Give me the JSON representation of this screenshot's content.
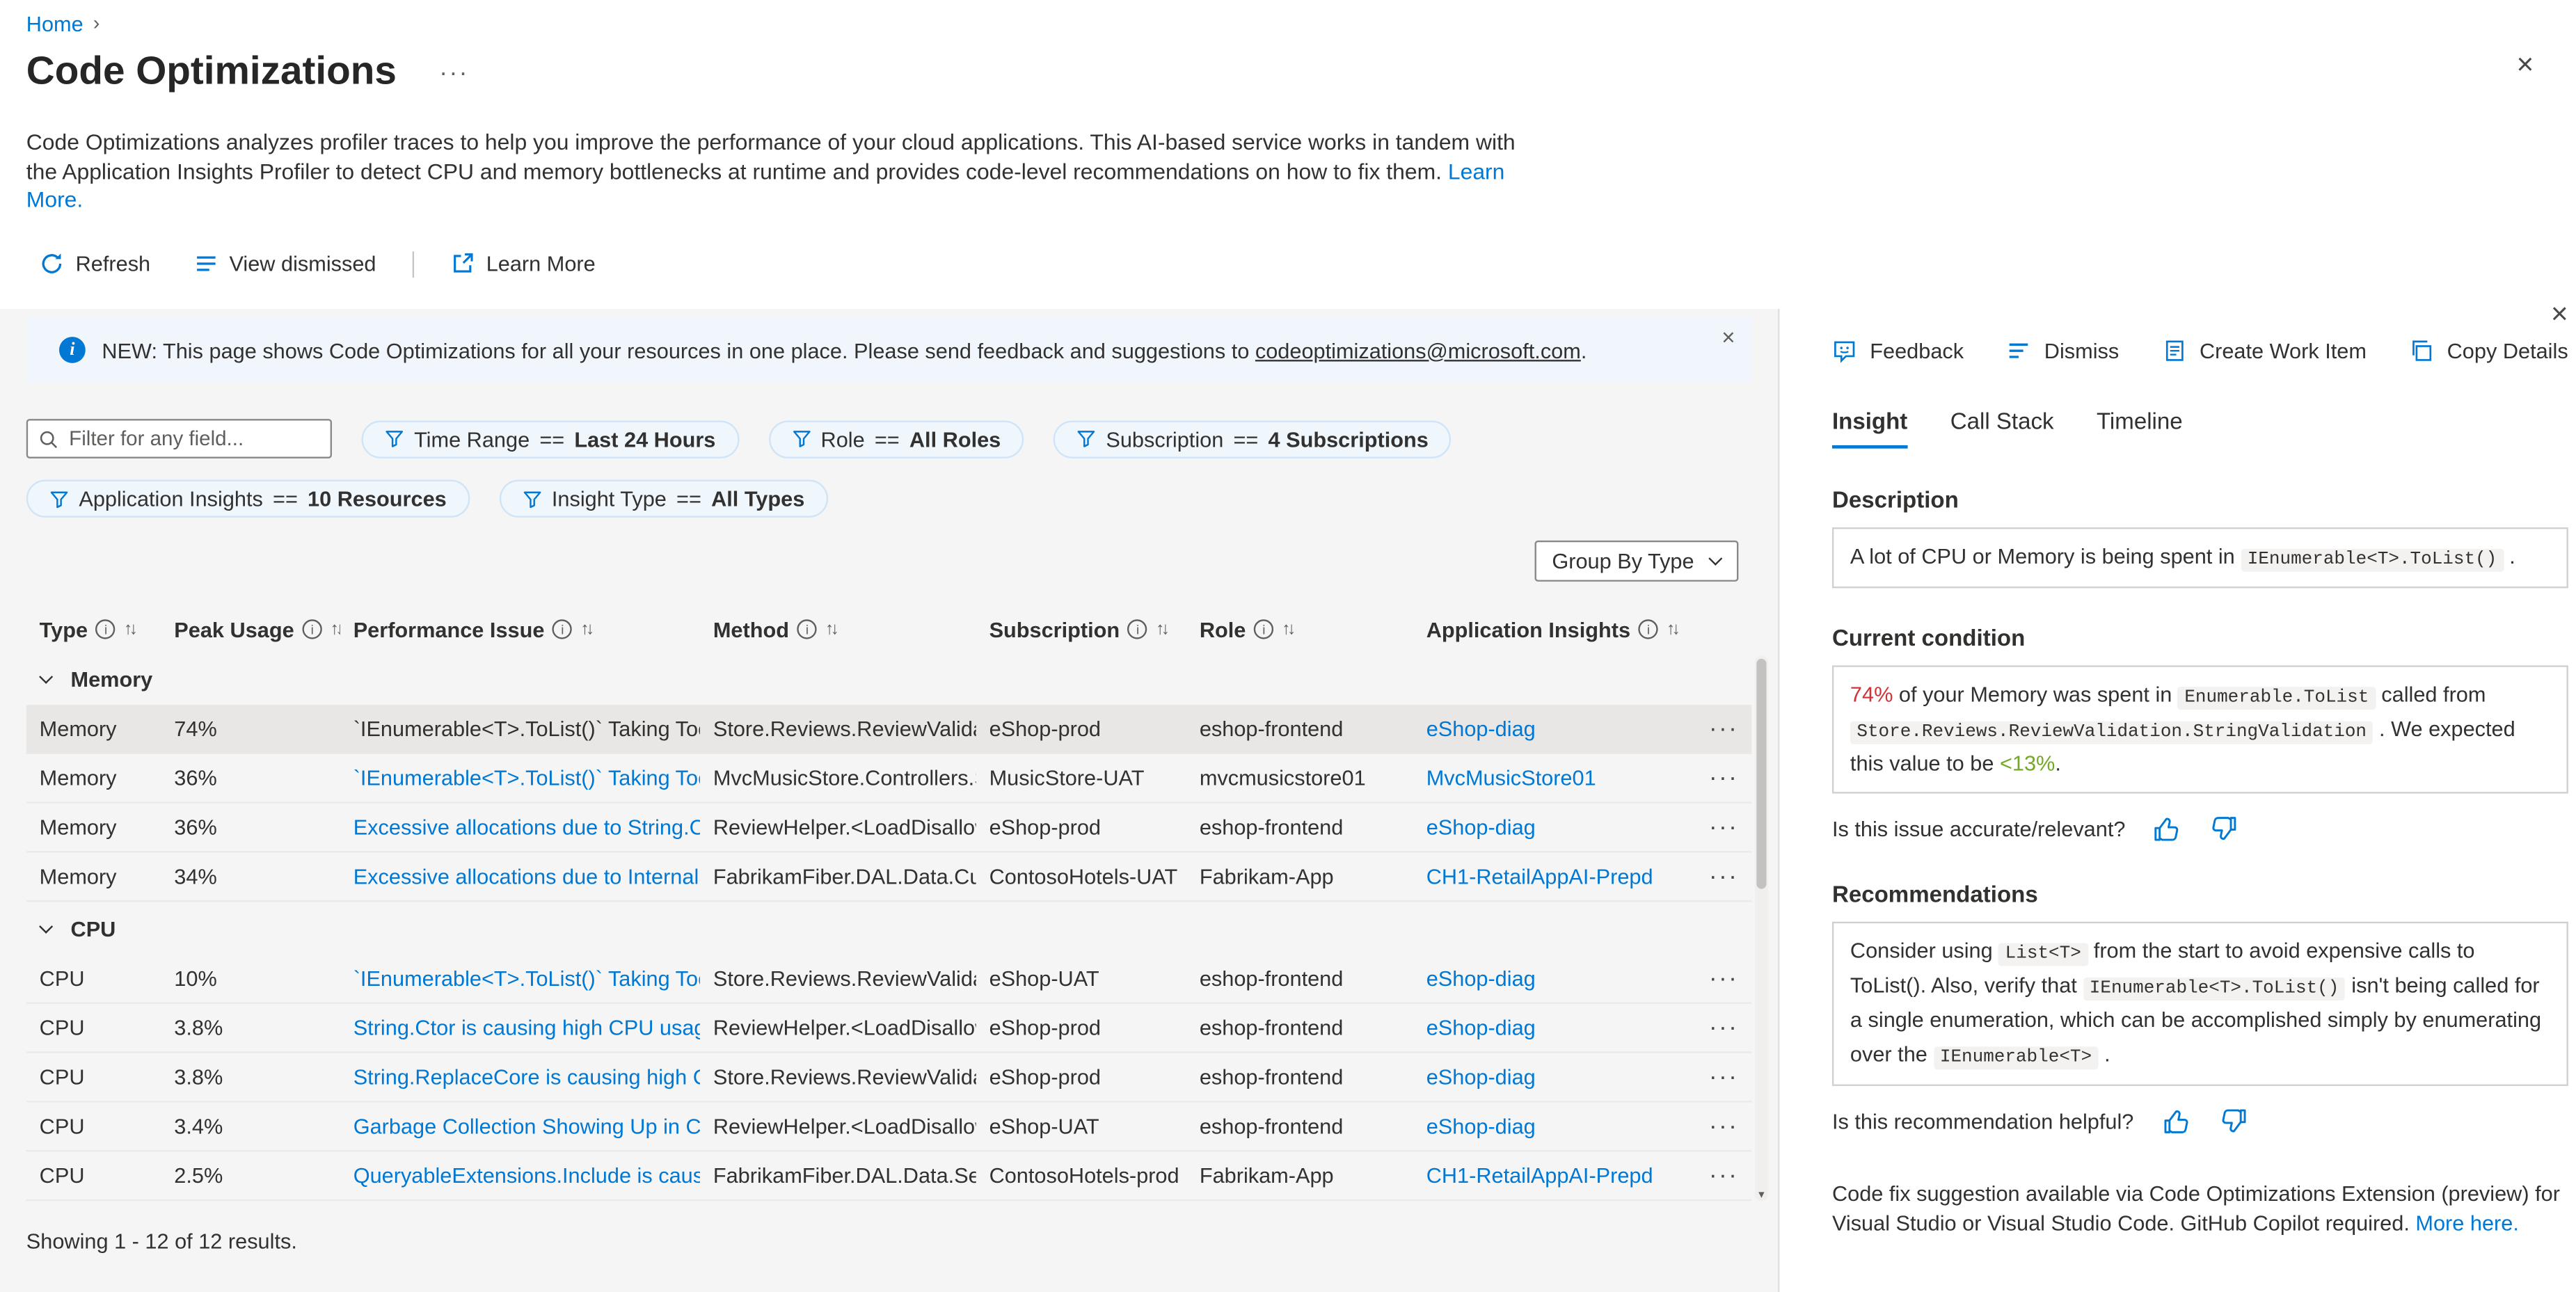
{
  "colors": {
    "accent": "#0078d4",
    "bad": "#d13438",
    "good": "#73aa24",
    "banner_bg": "#f0f6fc",
    "panel_bg": "#f5f5f5"
  },
  "breadcrumb": {
    "home": "Home"
  },
  "header": {
    "title": "Code Optimizations",
    "description": "Code Optimizations analyzes profiler traces to help you improve the performance of your cloud applications. This AI-based service works in tandem with the Application Insights Profiler to detect CPU and memory bottlenecks at runtime and provides code-level recommendations on how to fix them.",
    "learn_more_link": "Learn More."
  },
  "toolbar": {
    "refresh": "Refresh",
    "view_dismissed": "View dismissed",
    "learn_more": "Learn More"
  },
  "banner": {
    "text": "NEW: This page shows Code Optimizations for all your resources in one place. Please send feedback and suggestions to ",
    "link": "codeoptimizations@microsoft.com",
    "suffix": "."
  },
  "filters": {
    "search_placeholder": "Filter for any field...",
    "pills": [
      {
        "field": "Time Range",
        "op": "==",
        "value": "Last 24 Hours"
      },
      {
        "field": "Role",
        "op": "==",
        "value": "All Roles"
      },
      {
        "field": "Subscription",
        "op": "==",
        "value": "4 Subscriptions"
      },
      {
        "field": "Application Insights",
        "op": "==",
        "value": "10 Resources"
      },
      {
        "field": "Insight Type",
        "op": "==",
        "value": "All Types"
      }
    ]
  },
  "group_by": {
    "label": "Group By Type"
  },
  "table": {
    "columns": [
      "Type",
      "Peak Usage",
      "Performance Issue",
      "Method",
      "Subscription",
      "Role",
      "Application Insights"
    ],
    "groups": [
      {
        "name": "Memory",
        "rows": [
          {
            "type": "Memory",
            "peak": "74%",
            "issue": "`IEnumerable<T>.ToList()` Taking Too M",
            "method": "Store.Reviews.ReviewValidatio",
            "subscription": "eShop-prod",
            "role": "eshop-frontend",
            "app_insights": "eShop-diag",
            "selected": true
          },
          {
            "type": "Memory",
            "peak": "36%",
            "issue": "`IEnumerable<T>.ToList()` Taking Too M",
            "method": "MvcMusicStore.Controllers.Stc",
            "subscription": "MusicStore-UAT",
            "role": "mvcmusicstore01",
            "app_insights": "MvcMusicStore01"
          },
          {
            "type": "Memory",
            "peak": "36%",
            "issue": "Excessive allocations due to String.Ctor",
            "method": "ReviewHelper.<LoadDisallowe",
            "subscription": "eShop-prod",
            "role": "eshop-frontend",
            "app_insights": "eShop-diag"
          },
          {
            "type": "Memory",
            "peak": "34%",
            "issue": "Excessive allocations due to InternalSet",
            "method": "FabrikamFiber.DAL.Data.Custc",
            "subscription": "ContosoHotels-UAT",
            "role": "Fabrikam-App",
            "app_insights": "CH1-RetailAppAI-Prepd"
          }
        ]
      },
      {
        "name": "CPU",
        "rows": [
          {
            "type": "CPU",
            "peak": "10%",
            "issue": "`IEnumerable<T>.ToList()` Taking Too M",
            "method": "Store.Reviews.ReviewValidatio",
            "subscription": "eShop-UAT",
            "role": "eshop-frontend",
            "app_insights": "eShop-diag"
          },
          {
            "type": "CPU",
            "peak": "3.8%",
            "issue": "String.Ctor is causing high CPU usage",
            "method": "ReviewHelper.<LoadDisallowe",
            "subscription": "eShop-prod",
            "role": "eshop-frontend",
            "app_insights": "eShop-diag"
          },
          {
            "type": "CPU",
            "peak": "3.8%",
            "issue": "String.ReplaceCore is causing high CPU",
            "method": "Store.Reviews.ReviewValidatio",
            "subscription": "eShop-prod",
            "role": "eshop-frontend",
            "app_insights": "eShop-diag"
          },
          {
            "type": "CPU",
            "peak": "3.4%",
            "issue": "Garbage Collection Showing Up in CPU",
            "method": "ReviewHelper.<LoadDisallowe",
            "subscription": "eShop-UAT",
            "role": "eshop-frontend",
            "app_insights": "eShop-diag"
          },
          {
            "type": "CPU",
            "peak": "2.5%",
            "issue": "QueryableExtensions.Include is causing",
            "method": "FabrikamFiber.DAL.Data.Servic",
            "subscription": "ContosoHotels-prod",
            "role": "Fabrikam-App",
            "app_insights": "CH1-RetailAppAI-Prepd"
          }
        ]
      }
    ]
  },
  "results_summary": "Showing 1 - 12 of 12 results.",
  "detail": {
    "toolbar": {
      "feedback": "Feedback",
      "dismiss": "Dismiss",
      "create_work_item": "Create Work Item",
      "copy_details": "Copy Details"
    },
    "tabs": {
      "insight": "Insight",
      "call_stack": "Call Stack",
      "timeline": "Timeline"
    },
    "sections": {
      "description": "Description",
      "current_condition": "Current condition",
      "recommendations": "Recommendations"
    },
    "description": {
      "pre": "A lot of CPU or Memory is being spent in ",
      "code": "IEnumerable<T>.ToList()",
      "post": " ."
    },
    "condition": {
      "pct": "74%",
      "mid1": " of your Memory was spent in ",
      "code1": "Enumerable.ToList",
      "mid2": " called from ",
      "code2": "Store.Reviews.ReviewValidation.StringValidation",
      "mid3": " . We expected this value to be ",
      "good": "<13%",
      "end": "."
    },
    "issue_question": "Is this issue accurate/relevant?",
    "recommendation": {
      "pre": "Consider using ",
      "code1": "List<T>",
      "mid1": " from the start to avoid expensive calls to ToList(). Also, verify that ",
      "code2": "IEnumerable<T>.ToList()",
      "mid2": " isn't being called for a single enumeration, which can be accomplished simply by enumerating over the ",
      "code3": "IEnumerable<T>",
      "post": " ."
    },
    "helpful_question": "Is this recommendation helpful?",
    "codefix": {
      "text": "Code fix suggestion available via Code Optimizations Extension (preview) for Visual Studio or Visual Studio Code. GitHub Copilot required. ",
      "link": "More here."
    }
  }
}
